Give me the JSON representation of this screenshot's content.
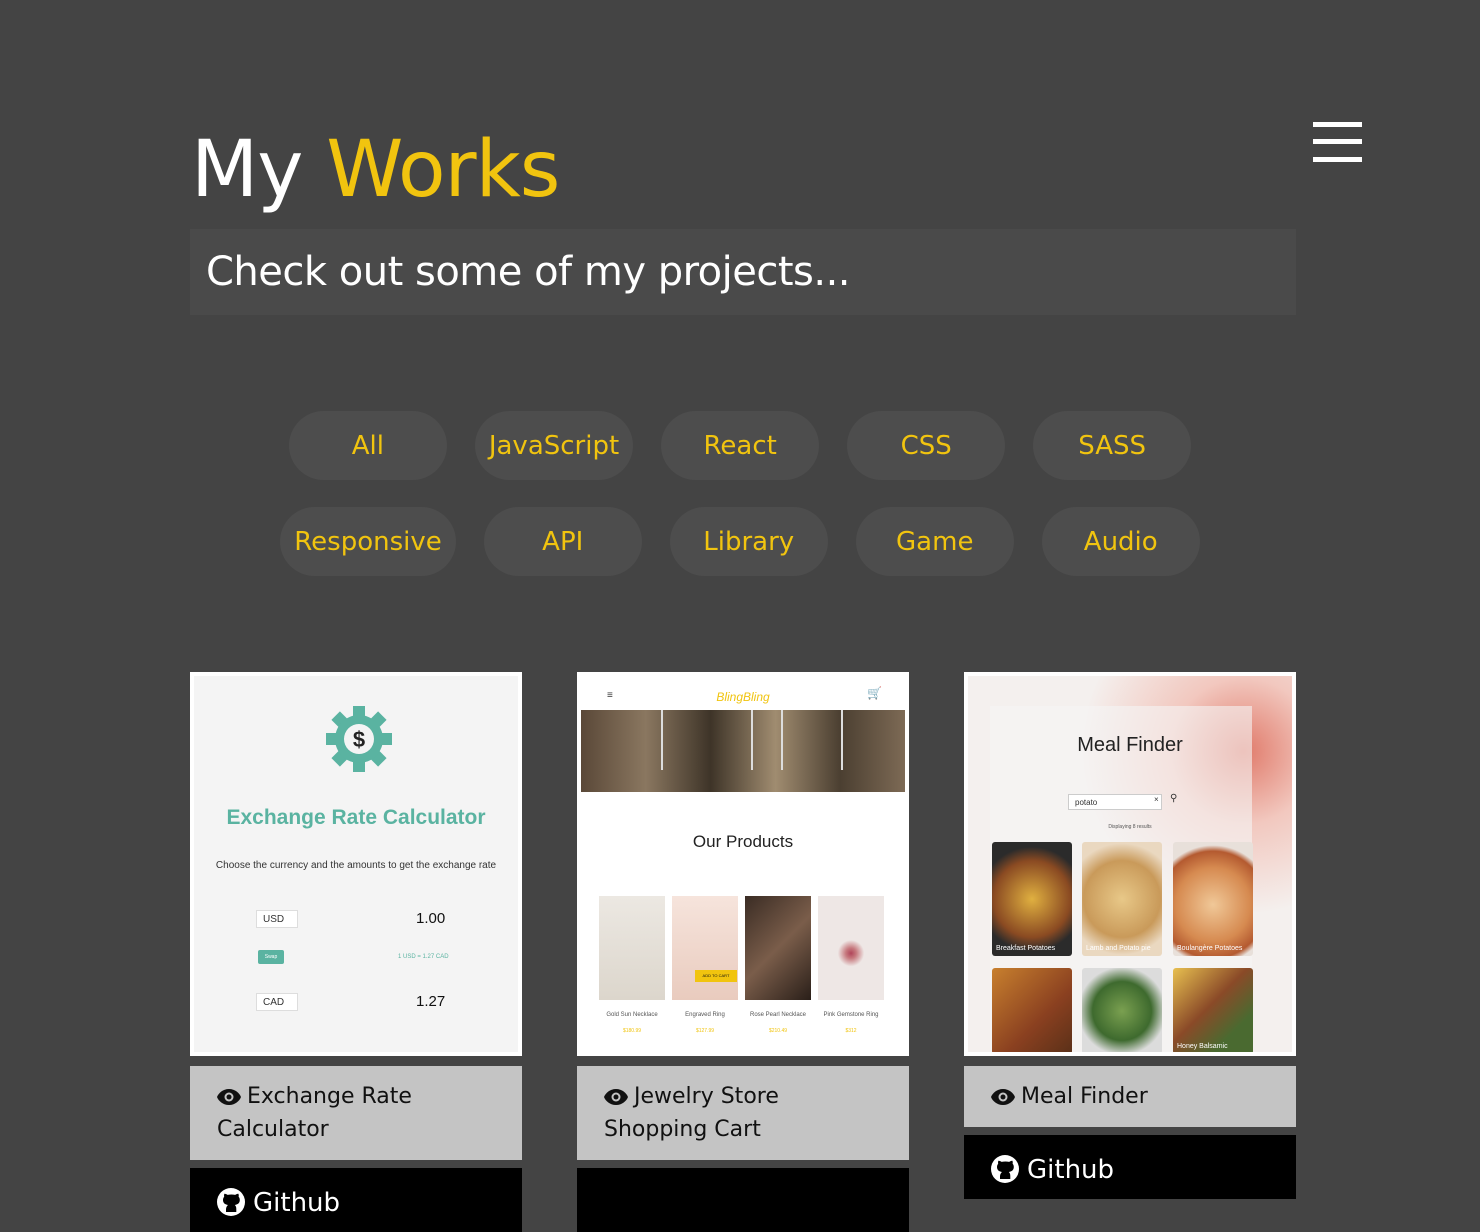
{
  "header": {
    "title_part1": "My",
    "title_part2": "Works",
    "subtitle": "Check out some of my projects..."
  },
  "menu": {
    "icon": "hamburger-menu-icon"
  },
  "filters": {
    "row1": [
      "All",
      "JavaScript",
      "React",
      "CSS",
      "SASS"
    ],
    "row2": [
      "Responsive",
      "API",
      "Library",
      "Game",
      "Audio"
    ]
  },
  "projects": [
    {
      "title": "Exchange Rate Calculator",
      "github_label": "Github",
      "thumb": {
        "heading": "Exchange Rate Calculator",
        "desc": "Choose the currency and the amounts to get the exchange rate",
        "cur1": "USD",
        "amt1": "1.00",
        "swap": "Swap",
        "rate": "1 USD = 1.27 CAD",
        "cur2": "CAD",
        "amt2": "1.27"
      }
    },
    {
      "title": "Jewelry Store Shopping Cart",
      "thumb": {
        "brand": "BlingBling",
        "heading": "Our Products",
        "add_to_cart": "ADD TO CART",
        "products": [
          {
            "name": "Gold Sun Necklace",
            "price": "$180.99"
          },
          {
            "name": "Engraved Ring",
            "price": "$127.99"
          },
          {
            "name": "Rose Pearl Necklace",
            "price": "$210.49"
          },
          {
            "name": "Pink Gemstone Ring",
            "price": "$312"
          }
        ]
      }
    },
    {
      "title": "Meal Finder",
      "github_label": "Github",
      "thumb": {
        "heading": "Meal Finder",
        "search_value": "potato",
        "results_label": "Displaying 8 results",
        "meals": [
          "Breakfast Potatoes",
          "Lamb and Potato pie",
          "Boulangère Potatoes",
          "",
          "",
          "Honey Balsamic"
        ]
      }
    }
  ],
  "colors": {
    "background": "#444444",
    "accent": "#f1c40f",
    "filter_bg": "#4d4d4d",
    "live_link_bg": "#c4c4c4",
    "github_bg": "#000000",
    "exchange_teal": "#5ab3a1"
  },
  "icons": {
    "view": "eye-icon",
    "github": "github-icon"
  }
}
